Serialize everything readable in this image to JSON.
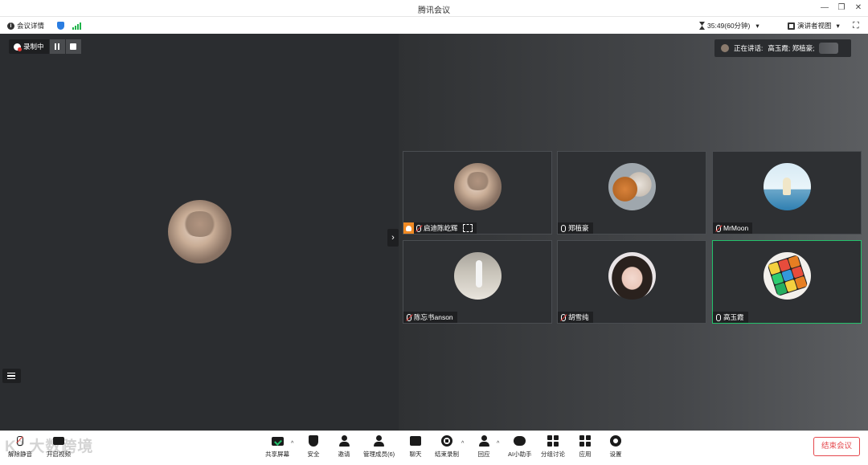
{
  "window": {
    "title": "腾讯会议",
    "minimize": "—",
    "restore": "❐",
    "close": "✕"
  },
  "infobar": {
    "meeting_details": "会议详情",
    "timer": "35:49(60分钟)",
    "view_mode": "演讲者视图",
    "dropdown_glyph": "▾",
    "fullscreen_glyph": "⛶"
  },
  "recording": {
    "label": "录制中"
  },
  "speaking": {
    "label": "正在讲话:",
    "names": "高玉霞; 郑植豪;"
  },
  "collapse_glyph": "›",
  "participants": [
    {
      "name": "启迪陈屹辉",
      "mic": "muted",
      "host": true,
      "active": false,
      "avatar": "cat"
    },
    {
      "name": "郑植豪",
      "mic": "on",
      "host": false,
      "active": false,
      "avatar": "dogcat"
    },
    {
      "name": "MrMoon",
      "mic": "muted",
      "host": false,
      "active": false,
      "avatar": "moon"
    },
    {
      "name": "陈忘书anson",
      "mic": "muted",
      "host": false,
      "active": false,
      "avatar": "girl1"
    },
    {
      "name": "胡雪纯",
      "mic": "muted",
      "host": false,
      "active": false,
      "avatar": "girl2"
    },
    {
      "name": "高玉霞",
      "mic": "on",
      "host": false,
      "active": true,
      "avatar": "cube"
    }
  ],
  "toolbar": {
    "watermark": "K⁰ 大数跨境",
    "mute": "解除静音",
    "video": "开启视频",
    "share_screen": "共享屏幕",
    "security": "安全",
    "invite": "邀请",
    "members": "管理成员(6)",
    "chat": "聊天",
    "end_recording": "结束录制",
    "react": "回应",
    "ai_assistant": "AI小助手",
    "breakout": "分组讨论",
    "apps": "应用",
    "settings": "设置",
    "end_meeting": "结束会议",
    "caret": "^"
  },
  "colors": {
    "accent_green": "#23c16b",
    "end_red": "#e5484d",
    "host_orange": "#f08a24"
  }
}
